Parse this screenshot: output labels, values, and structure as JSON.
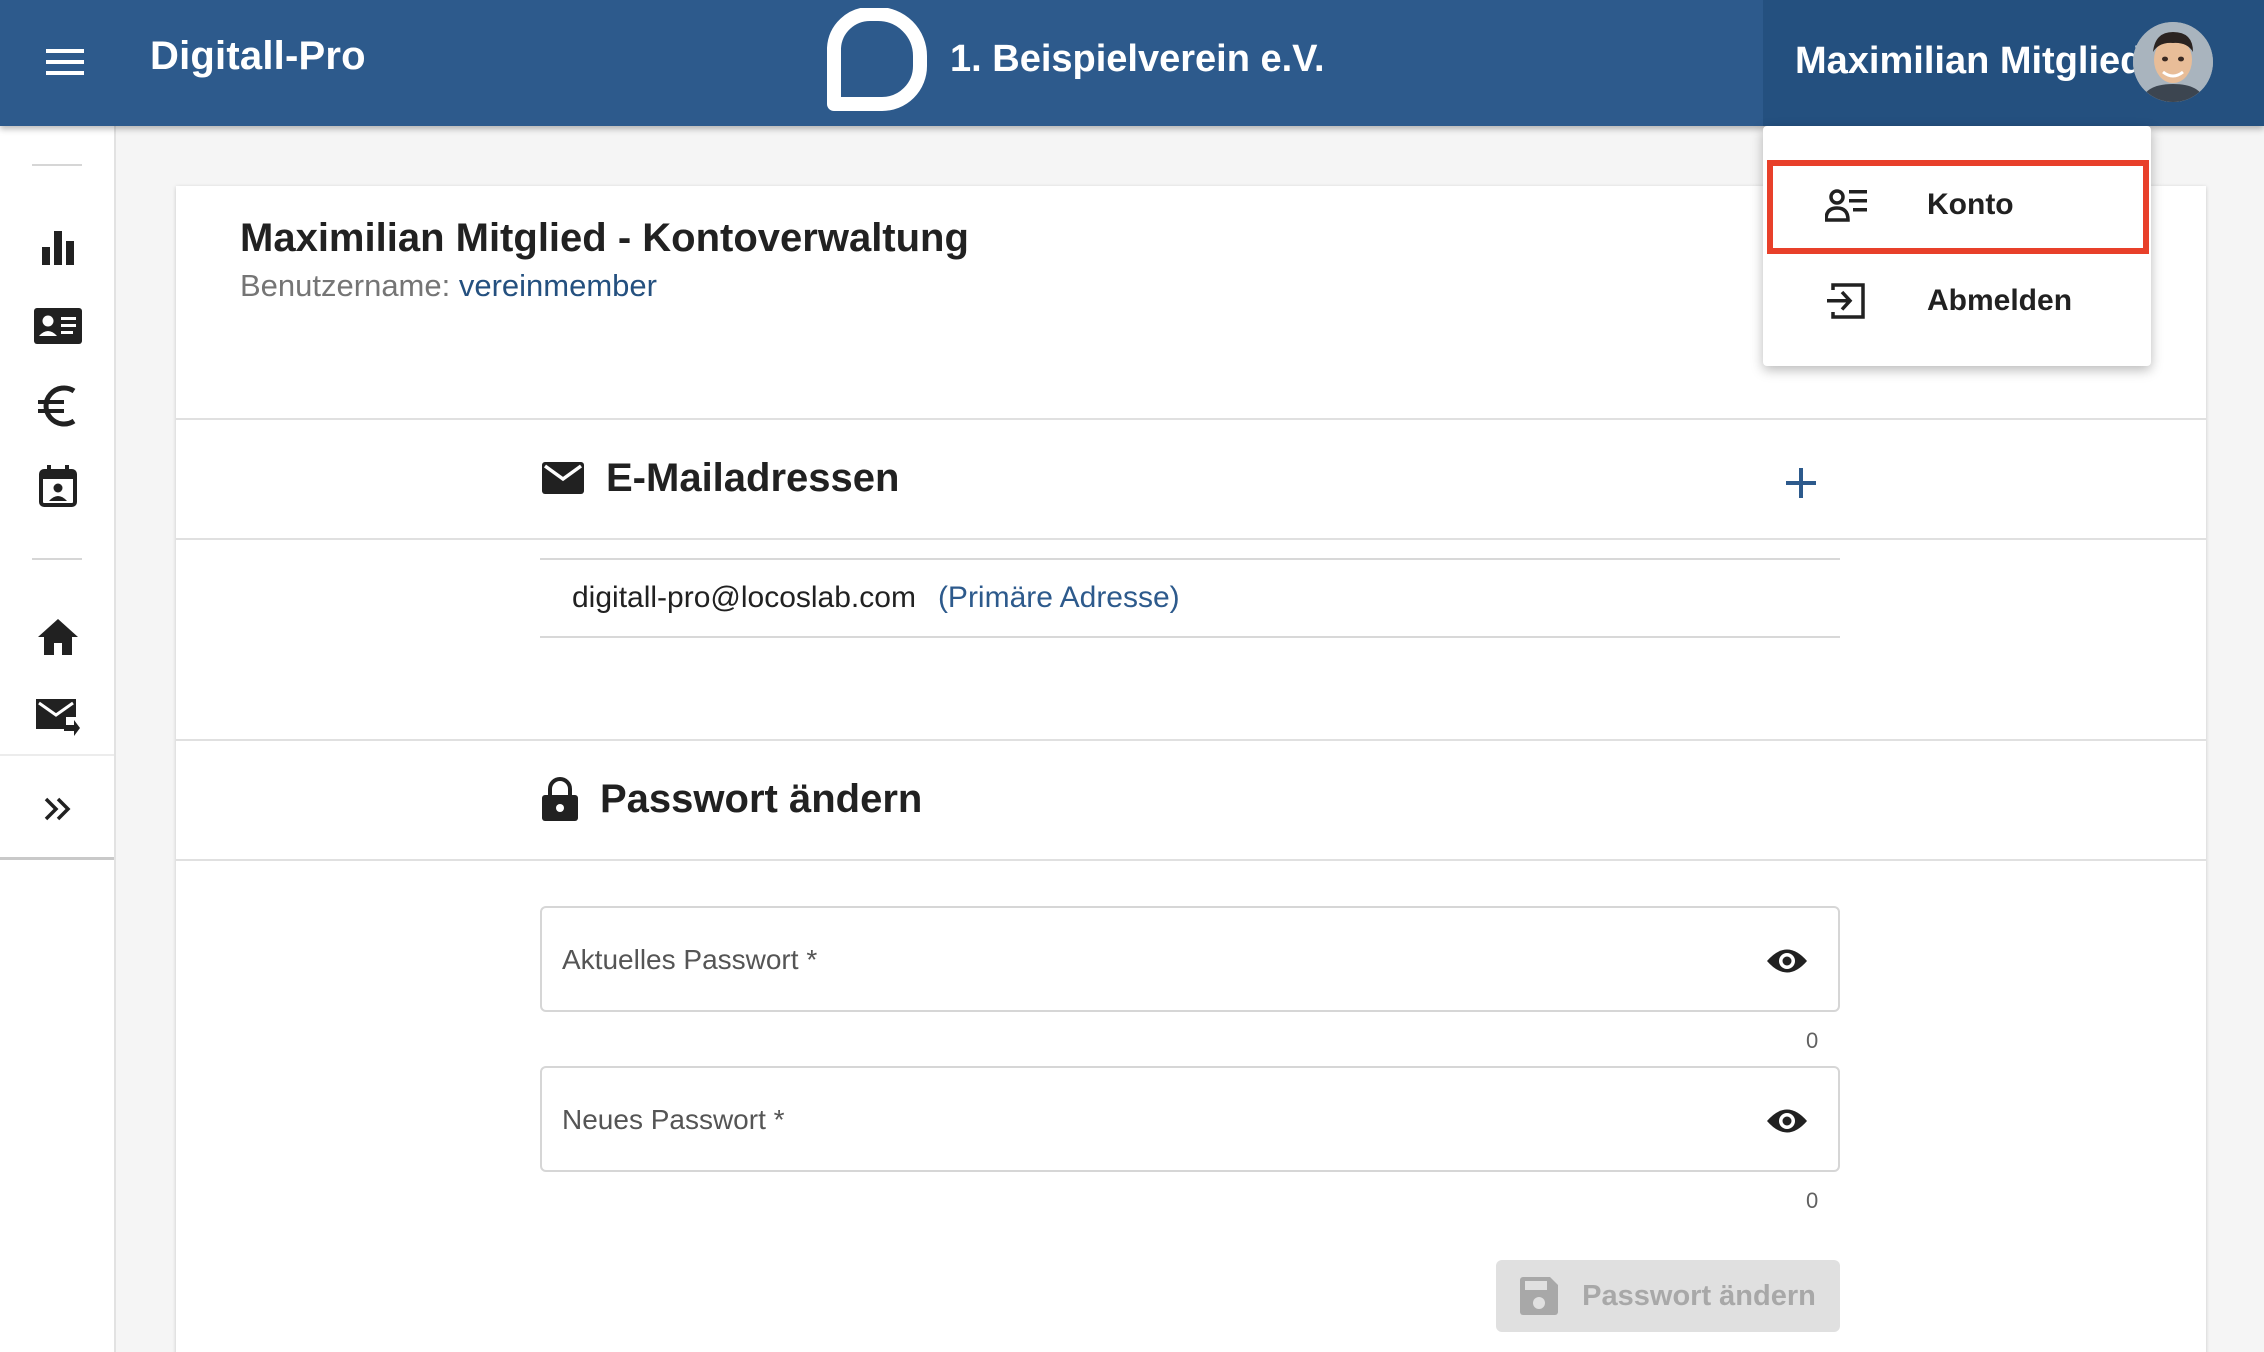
{
  "header": {
    "app_title": "Digitall-Pro",
    "club_name": "1. Beispielverein e.V.",
    "user_name": "Maximilian Mitglied"
  },
  "nav_rail": {
    "items": [
      "chart-icon",
      "member-card-icon",
      "euro-icon",
      "calendar-person-icon",
      "home-icon",
      "mail-forward-icon",
      "expand-icon"
    ]
  },
  "user_menu": {
    "items": [
      {
        "label": "Konto",
        "icon": "account-list-icon"
      },
      {
        "label": "Abmelden",
        "icon": "logout-icon"
      }
    ],
    "highlight_color": "#e8402a"
  },
  "account": {
    "title": "Maximilian Mitglied - Kontoverwaltung",
    "username_label": "Benutzername:",
    "username": "vereinmember"
  },
  "emails": {
    "title": "E-Mailadressen",
    "items": [
      {
        "address": "digitall-pro@locoslab.com",
        "tag": "(Primäre Adresse)"
      }
    ]
  },
  "password": {
    "title": "Passwort ändern",
    "current_label": "Aktuelles Passwort *",
    "current_count": "0",
    "new_label": "Neues Passwort *",
    "new_count": "0",
    "submit_label": "Passwort ändern"
  },
  "colors": {
    "primary": "#2d5a8c",
    "primary_dark": "#24507f",
    "accent_text": "#2d5a8c"
  }
}
